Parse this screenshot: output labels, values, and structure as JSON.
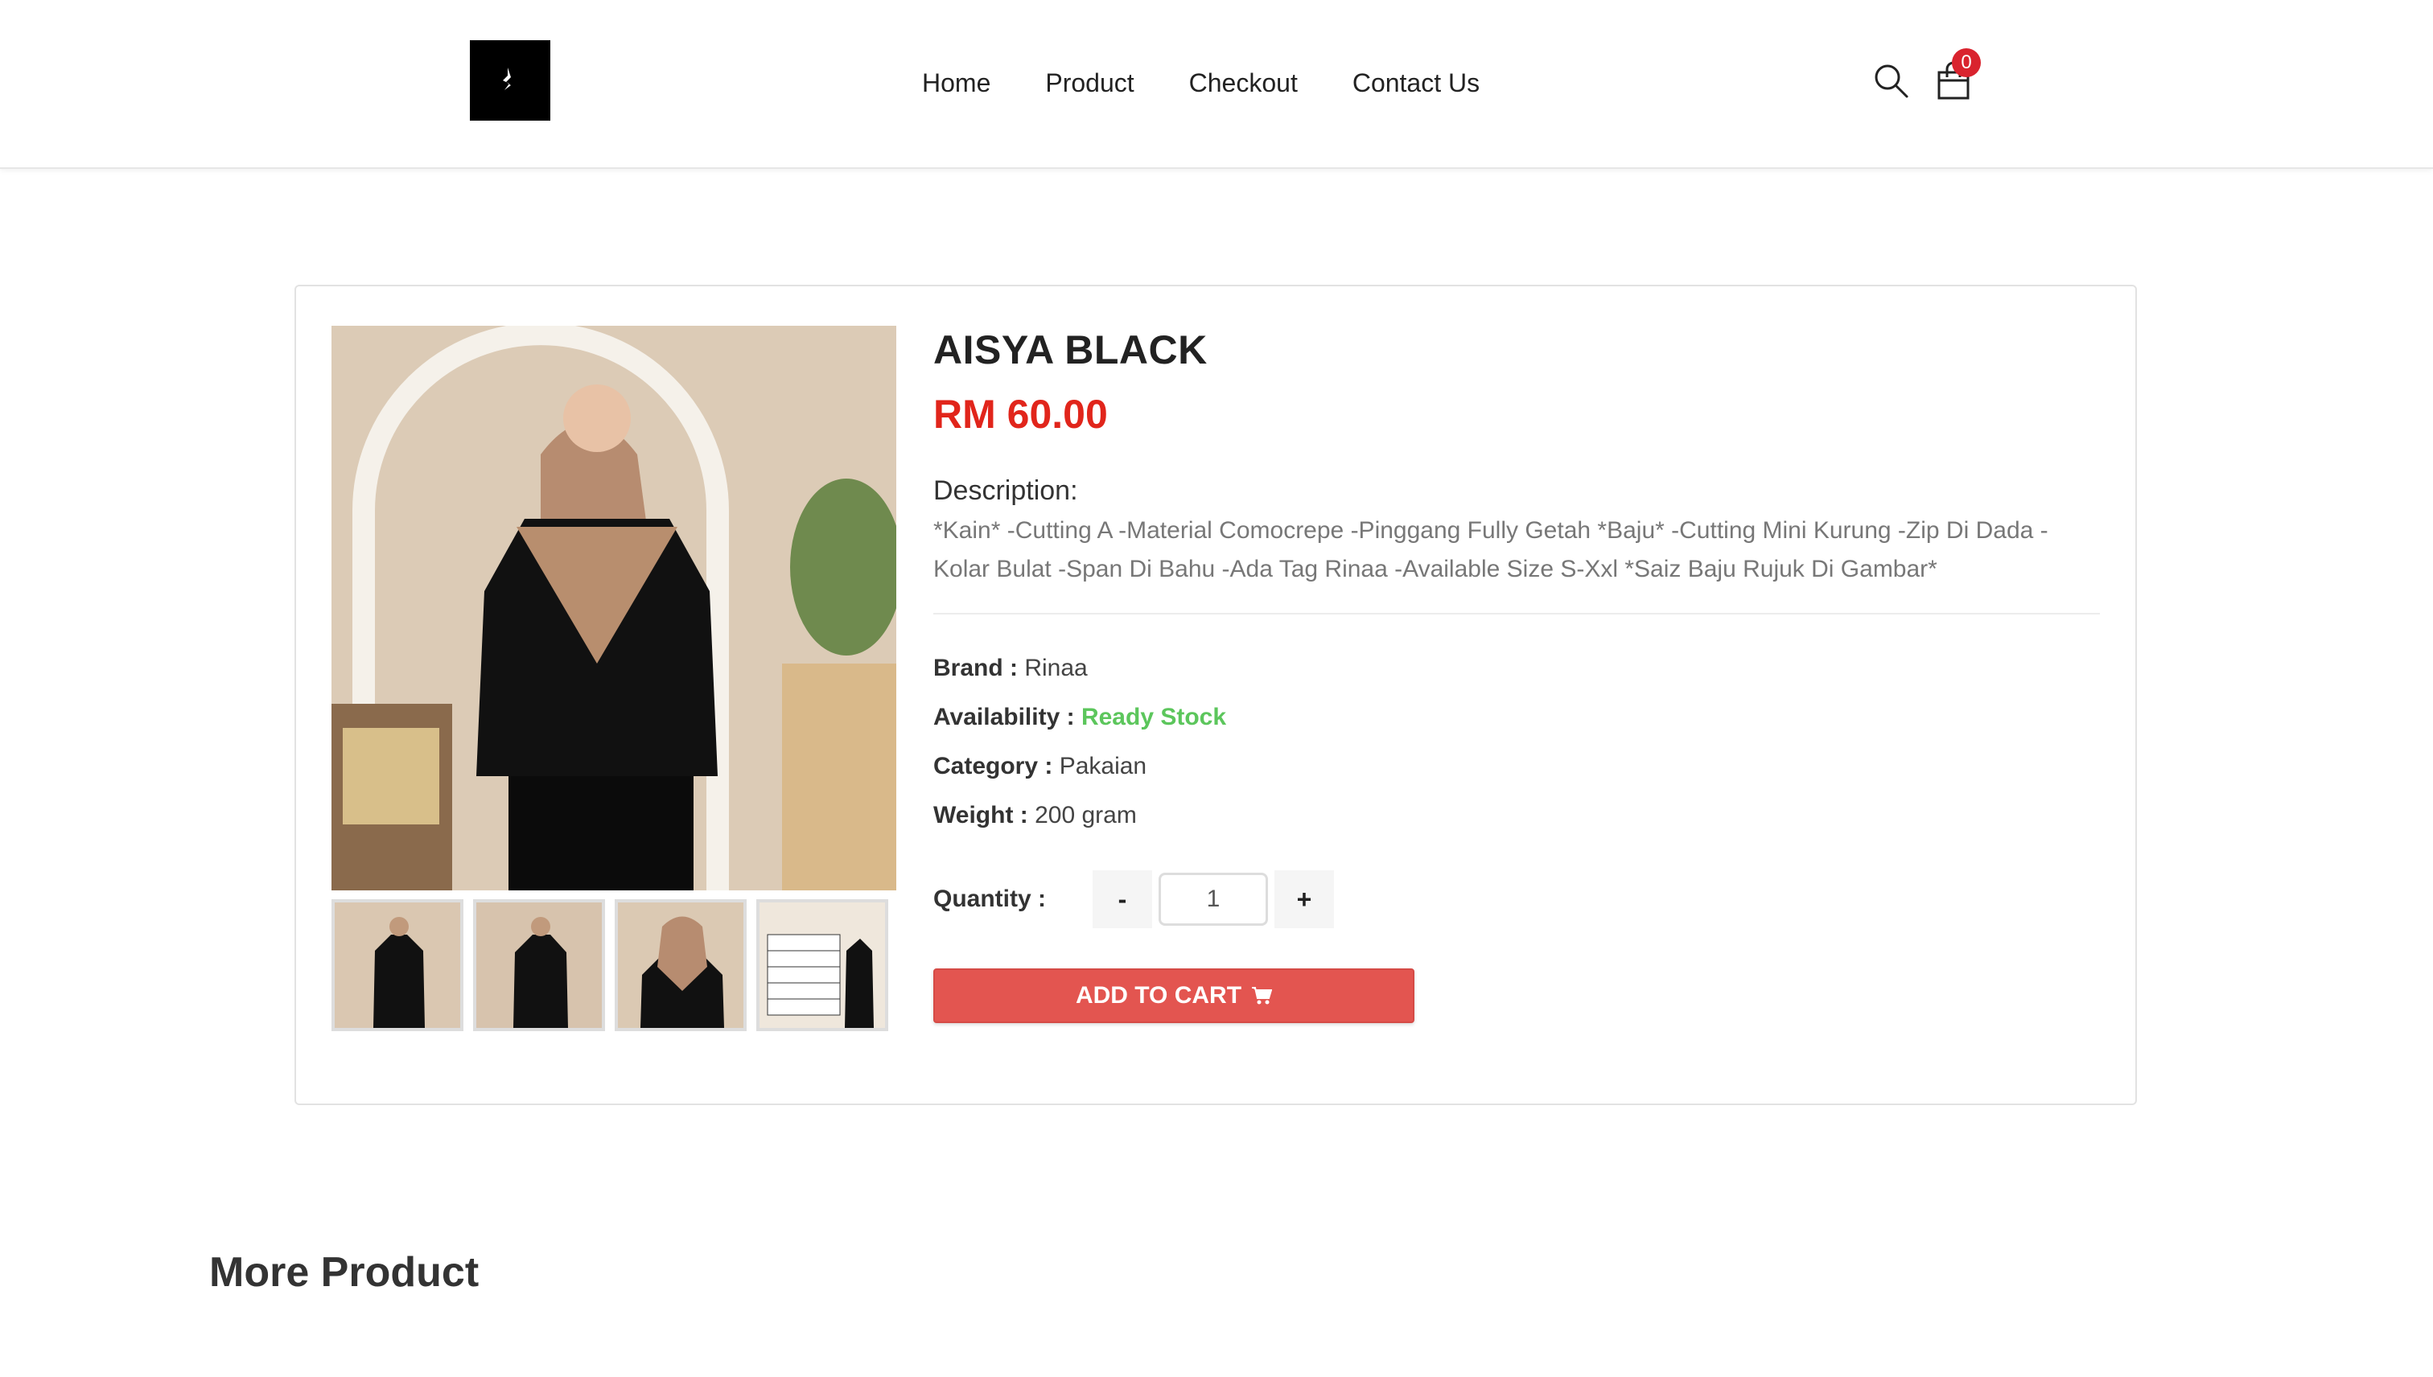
{
  "header": {
    "nav": [
      "Home",
      "Product",
      "Checkout",
      "Contact Us"
    ],
    "cart_count": "0"
  },
  "product": {
    "title": "AISYA BLACK",
    "price": "RM 60.00",
    "description_label": "Description:",
    "description": "*Kain* -Cutting A -Material Comocrepe -Pinggang Fully Getah *Baju* -Cutting Mini Kurung -Zip Di Dada -Kolar Bulat -Span Di Bahu -Ada Tag Rinaa -Available Size S-Xxl *Saiz Baju Rujuk Di Gambar*",
    "brand_label": "Brand :",
    "brand": "Rinaa",
    "availability_label": "Availability :",
    "availability": "Ready Stock",
    "category_label": "Category :",
    "category": "Pakaian",
    "weight_label": "Weight :",
    "weight": "200 gram",
    "quantity_label": "Quantity :",
    "quantity": "1",
    "minus": "-",
    "plus": "+",
    "add_to_cart": "ADD TO CART"
  },
  "more_product_title": "More Product",
  "colors": {
    "price": "#e1251b",
    "ready_stock": "#5cc65c",
    "cart_button": "#e35550",
    "badge": "#d9232e"
  },
  "icons": [
    "logo-icon",
    "search-icon",
    "cart-icon",
    "shopping-cart-icon"
  ]
}
